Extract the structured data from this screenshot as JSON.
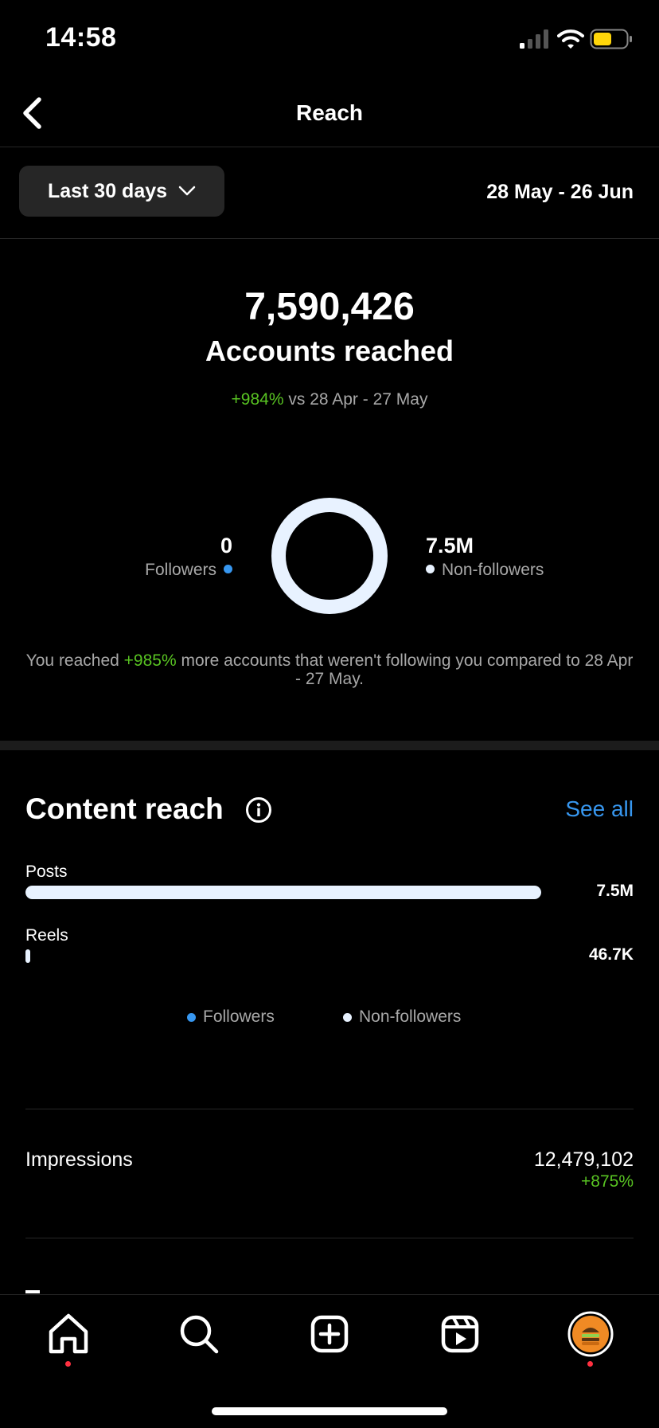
{
  "status_bar": {
    "time": "14:58"
  },
  "header": {
    "title": "Reach"
  },
  "filter": {
    "range_label": "Last 30 days",
    "date_range": "28 May - 26 Jun"
  },
  "summary": {
    "total": "7,590,426",
    "label": "Accounts reached",
    "change": "+984%",
    "compare_text": " vs 28 Apr - 27 May"
  },
  "audience": {
    "followers_value": "0",
    "followers_label": "Followers",
    "non_followers_value": "7.5M",
    "non_followers_label": "Non-followers",
    "followers_share": 0.0,
    "note_prefix": "You reached ",
    "note_change": "+985%",
    "note_suffix": " more accounts that weren't following you compared to 28 Apr - 27 May."
  },
  "content_reach": {
    "title": "Content reach",
    "see_all": "See all",
    "rows": [
      {
        "label": "Posts",
        "value": "7.5M",
        "fraction": 1.0
      },
      {
        "label": "Reels",
        "value": "46.7K",
        "fraction": 0.006
      }
    ],
    "legend": {
      "followers": "Followers",
      "non_followers": "Non-followers"
    }
  },
  "impressions": {
    "label": "Impressions",
    "value": "12,479,102",
    "change": "+875%"
  },
  "colors": {
    "accent": "#3797f0",
    "positive": "#58c322",
    "non_followers": "#e8f2ff",
    "notification": "#ff3040"
  },
  "tabs": [
    "home-icon",
    "search-icon",
    "create-icon",
    "reels-icon",
    "profile-avatar"
  ]
}
